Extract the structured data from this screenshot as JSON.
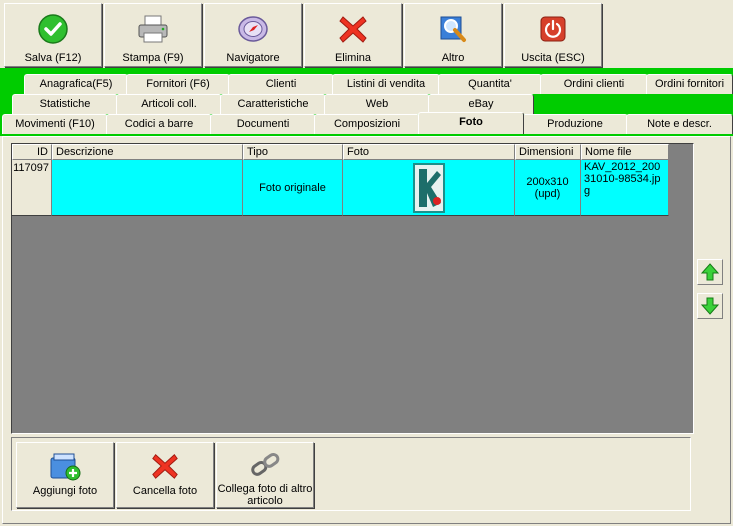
{
  "toolbar": {
    "buttons": [
      {
        "label": "Salva (F12)",
        "icon": "check-icon"
      },
      {
        "label": "Stampa (F9)",
        "icon": "printer-icon"
      },
      {
        "label": "Navigatore",
        "icon": "compass-icon"
      },
      {
        "label": "Elimina",
        "icon": "x-icon"
      },
      {
        "label": "Altro",
        "icon": "magnifier-icon"
      },
      {
        "label": "Uscita (ESC)",
        "icon": "power-icon"
      }
    ]
  },
  "tabs": {
    "row1": [
      "Anagrafica(F5)",
      "Fornitori (F6)",
      "Clienti",
      "Listini di vendita",
      "Quantita'",
      "Ordini clienti",
      "Ordini fornitori"
    ],
    "row2": [
      "Statistiche",
      "Articoli coll.",
      "Caratteristiche",
      "Web",
      "eBay"
    ],
    "row3": [
      "Movimenti (F10)",
      "Codici a barre",
      "Documenti",
      "Composizioni",
      "Foto",
      "Produzione",
      "Note e descr."
    ],
    "active": "Foto"
  },
  "grid": {
    "columns": [
      "ID",
      "Descrizione",
      "Tipo",
      "Foto",
      "Dimensioni",
      "Nome file"
    ],
    "rows": [
      {
        "id": "117097",
        "descrizione": "",
        "tipo": "Foto originale",
        "foto": "thumbnail",
        "dimensioni": "200x310 (upd)",
        "nome_file": "KAV_2012_20031010-98534.jpg"
      }
    ]
  },
  "side_buttons": {
    "up": "arrow-up-icon",
    "down": "arrow-down-icon"
  },
  "bottom_buttons": [
    {
      "label": "Aggiungi foto",
      "icon": "add-photo-icon"
    },
    {
      "label": "Cancella foto",
      "icon": "x-icon"
    },
    {
      "label": "Collega foto di altro articolo",
      "icon": "link-icon"
    }
  ],
  "colors": {
    "tab_background": "#00cc00",
    "selected_row": "#00ffff",
    "grid_background": "#808080",
    "window": "#ece9d8"
  }
}
